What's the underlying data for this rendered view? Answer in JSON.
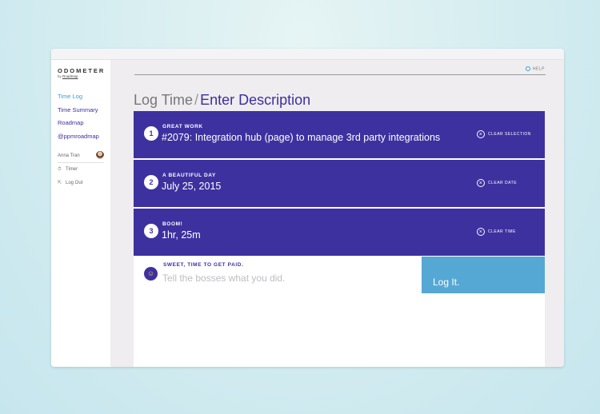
{
  "app": {
    "logo": "ODOMETER",
    "logo_sub_prefix": "by ",
    "logo_sub_link": "Roadmap"
  },
  "sidebar": {
    "nav": [
      {
        "label": "Time Log",
        "active": true
      },
      {
        "label": "Time Summary",
        "active": false
      },
      {
        "label": "Roadmap",
        "active": false
      },
      {
        "label": "@ppmroadmap",
        "active": false
      }
    ],
    "user_name": "Anna Tran",
    "timer_label": "Timer",
    "logout_label": "Log Out"
  },
  "header": {
    "help_label": "HELP"
  },
  "page": {
    "title_main": "Log Time",
    "title_sep": "/",
    "title_current": "Enter Description"
  },
  "steps": [
    {
      "number": "1",
      "label": "GREAT WORK",
      "value": "#2079: Integration hub (page) to manage 3rd party integrations",
      "clear_label": "CLEAR SELECTION"
    },
    {
      "number": "2",
      "label": "A BEAUTIFUL DAY",
      "value": "July 25, 2015",
      "clear_label": "CLEAR DATE"
    },
    {
      "number": "3",
      "label": "BOOM!",
      "value": "1hr, 25m",
      "clear_label": "CLEAR TIME"
    }
  ],
  "description": {
    "label": "SWEET, TIME TO GET PAID.",
    "placeholder": "Tell the bosses what you did.",
    "value": "",
    "submit_label": "Log It."
  },
  "icons": {
    "clear": "close-circle-icon",
    "help": "gear-icon",
    "emoji": "smiley-icon",
    "timer": "stopwatch-icon",
    "logout": "logout-icon"
  },
  "colors": {
    "primary": "#3d31a0",
    "accent": "#56a8d4",
    "active_nav": "#3aa0d2"
  }
}
